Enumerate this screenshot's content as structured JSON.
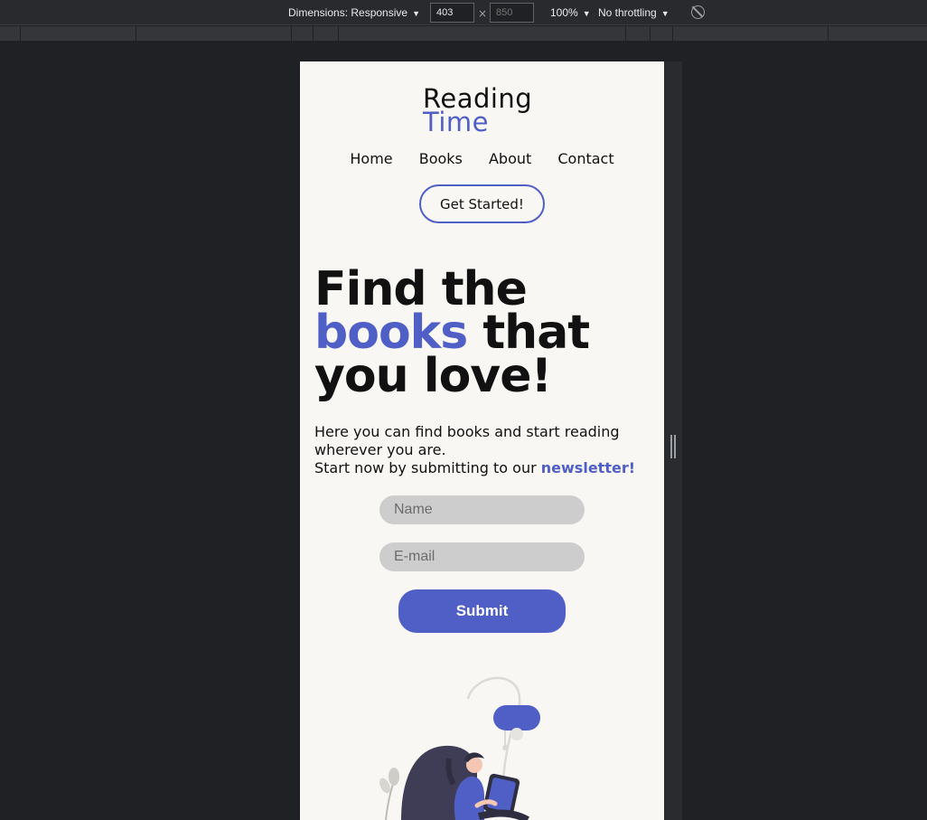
{
  "devtools": {
    "dimensions_label": "Dimensions: Responsive",
    "width_value": "403",
    "height_value": "850",
    "zoom_label": "100%",
    "throttling_label": "No throttling",
    "times_symbol": "×",
    "caret": "▼",
    "rotate_icon": "rotate-icon"
  },
  "site": {
    "logo": {
      "line1": "Reading",
      "line2": "Time"
    },
    "nav": [
      "Home",
      "Books",
      "About",
      "Contact"
    ],
    "cta_label": "Get Started!",
    "hero": {
      "part1": "Find the",
      "accent": "books",
      "part2": "that",
      "part3": "you love!"
    },
    "description": {
      "line1": "Here you can find books and start reading wherever you are.",
      "line2": "Start now by submitting to our",
      "accent": "newsletter!"
    },
    "form": {
      "name_placeholder": "Name",
      "email_placeholder": "E-mail",
      "submit_label": "Submit"
    }
  },
  "colors": {
    "accent": "#4f5fc5",
    "page_background": "#f8f7f4",
    "field_background": "#cdcdcd"
  }
}
